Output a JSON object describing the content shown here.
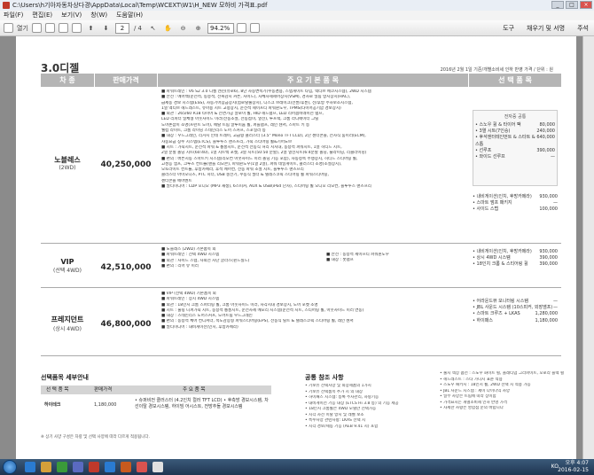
{
  "window": {
    "title": "C:\\Users\\h기아자동차상다경\\AppData\\Local\\Temp\\WCEXT\\W1\\H_NEW 모하비 가격표.pdf"
  },
  "menu": [
    "파일(F)",
    "편집(E)",
    "보기(V)",
    "창(W)",
    "도움말(H)"
  ],
  "toolbar": {
    "open": "열기",
    "page_current": "2",
    "page_total": "/ 4",
    "zoom": "94.2%",
    "tools": "도구",
    "fill_sign": "채우기 및 서명",
    "comment": "주석"
  },
  "doc": {
    "title": "3.0디젤",
    "note": "2016년 2월 1일 기준/개별소비세 인하 반영 가격 / 단위 : 원",
    "headers": {
      "model": "차 종",
      "price": "판매가격",
      "features": "주 요 기 본 품 목",
      "options": "선 택 품 목"
    },
    "models": [
      {
        "name": "노블레스",
        "sub": "(2WD)",
        "price": "40,250,000",
        "features": [
          "■ 파워트레인 : V6 S2 3.0 디젤 엔진(유로6), 8단 자동변속기(수동겸용, 스텝게이트 타입, 액티브 에코시스템), 2WD 시스템",
          "■ 안전 : 에어백(운전석, 동승석, 전복감지 커튼, 사이드), 차체자세제어장치(VSM), 경사로 밀림 방지장치(HAC),",
          "   급제동 경보 시스템(ESS), 차동기어잠금장치(험로탈출장치), 디스크 브레이크(전륜/후륜), 전/후방 주차보조시스템,",
          "   1열 액티브 헤드레스트, 유아용 시트 고정장치, 운전석 세이프티 파워윈도우, TPMS(타이어공기압 경보장치)",
          "■ 외관 : 265/60 R18 타이어 & 전면가공 알로이 휠, HID 헤드램프, LED 리어콤비네이션 램프,",
          "   LED 리피터 일체형 아웃사이드 미러(전동조절, 전동접이, 열선), 루프랙, 크롬 라디에이터 그릴",
          "   도어손잡이 조명(프런트 도어), 메탈 트림 알루미늄 휠, 퍼들램프, 레인 센서, 스마트 키 등",
          "   웰컴 라이트, 크롬 라이닝 스테인리스 도어 스커프, 스포일러 등",
          "■ 내장 : 우드그레인, 리거지 인테 트레이, 고급형 클러스터 (3.5\" Mono TFT LCD), 2단 센터콘솔, 전자식 룸미러(ECM),",
          "   자동요금 징수 시스템(ETCS), 블루투스 핸즈프리, 가죽 스티어링 휠&기어노브",
          "■ 시트 : 가죽시트, 운전석 파워 & 통풍시트, 운전석 전동식 허리 지지대, 동승석 파워시트, 1열 히티드 시트,",
          "   2열 분할 폴딩 시트(60:40), 1열 시트백 포켓, 3열 시트(50:50 분할), 2열 열선시트(6:4분할 폴딩, 슬라이딩, 리클라이닝)",
          "■ 편의 : 버튼시동 스마트키 시스템(리모컨 아웃사이드 미러 폴딩 기능 포함), 자동정속 주행장치, 히티드 스티어링 휠,",
          "   고성능 앰프, 크루즈 컨트롤(핸들 리모콘), 파워윈도우(1열 2열), 파워 테일게이트, 클러스터 조명(조절장치),",
          "   오토라이트 컨트롤, 후방카메라, 후석 에어컨, 전동 파워 조절 시트, 블루투스 핸즈프리",
          "   클러스터 아이오니즈, PTC 히터, USB 충전기, 수동식 필터 & 텔레스코픽 스티어링 휠 파워스티어링,",
          "   센터콘솔 에어벤트",
          "■ 멀티미디어 : CDP 오디오 (MP3 재생), 6스피커, AUX & USB(iPod 단자), 스티어링 휠 오디오 리모컨, 블루투스 핸즈프리"
        ],
        "options_box_title": "전자증 공통",
        "options": [
          [
            "• 스노우 휠 & 타이어 팩",
            "80,000"
          ],
          [
            "• 3열 시트(7인승)",
            "240,000"
          ],
          [
            "• 후석엔터테인먼트 & 스타트 & 스톱",
            "640,000"
          ],
          [
            "• 선루프",
            "390,000"
          ],
          [
            "• 와이드 선루프",
            "—"
          ]
        ],
        "options2": [
          [
            "• 내비게이션(인치, 후방카메라)",
            "930,000"
          ],
          [
            "• 스마트 앰프 패키지",
            "—"
          ],
          [
            "• 사이드 스텝",
            "100,000"
          ]
        ]
      },
      {
        "name": "VIP",
        "sub": "(선택 4WD)",
        "price": "42,510,000",
        "features": [
          "■ 노블레스 (2WD) 기본품목 외",
          "■ 파워트레인 : 선택 4WD 시스템",
          "■ 외관 : 사이드 스텝, 자외선 차단 글라스(윈드실드)",
          "■ 편의 : 리어 뷰 미러"
        ],
        "features_right": [
          "■ 안전 : 동승석 세이프티 파워윈도우",
          "■ 내장 : 풋램프"
        ],
        "options": [
          [
            "• 내비게이션(인치, 후방카메라)",
            "930,000"
          ],
          [
            "• 상시 4WD 시스템",
            "390,000"
          ],
          [
            "• 18인치 크롬 & 스티어링 휠",
            "390,000"
          ]
        ]
      },
      {
        "name": "프레지던트",
        "sub": "(상시 4WD)",
        "price": "46,800,000",
        "features": [
          "■ VIP (선택 4WD) 기본품목 외",
          "■ 파워트레인 : 상시 4WD 시스템",
          "■ 외관 : 18인치 크롬 스퍼터링 휠, 크롬 아웃사이드 미러, 사각지대 경보장치, 도어 포켓 조명",
          "■ 시트 : 풀링 니퍼가죽 시트, 동승석 통풍시트, 운전자세 메모리 시스템(운전석 시트, 스티어링 휠, 아웃사이드 미러 연동)",
          "■ 내장 : 스테인리스 도어스커프, 도어트림 우드그레인",
          "■ 편의 : 동승석 체어 컨디셔너, 속도감응형 파워스티어링(EPS), 전동식 틸트 & 텔레스코픽 스티어링 휠, 레인 센서",
          "■ 멀티미디어 : 내비게이션(인치, 후방카메라)"
        ],
        "options": [
          [
            "• 어라운드뷰 모니터링 시스템",
            "—"
          ],
          [
            "• JBL 사운드 시스템 (10스피커, 외장앰프)",
            "—"
          ],
          [
            "• 스마트 크루즈 + LKAS",
            "1,280,000"
          ],
          [
            "• 하이패스",
            "1,180,000"
          ]
        ]
      }
    ],
    "section": {
      "title": "선택품목 세부안내",
      "cols": [
        "선 택 품 목",
        "판매가격",
        "주 요 품 목"
      ],
      "rows": [
        {
          "item": "하이테크",
          "price": "1,180,000",
          "desc": "• 슈퍼비전 클러스터 (4.2인치 컬러 TFT LCD) • 후측방 경보시스템, 차선이탈 경보시스템, 하이빔 어시스트, 전방추돌 경보시스템"
        }
      ],
      "footnote": "※ 상기 사양 구성은 차량 및 선택 사양에 따라 다르게 적용됩니다."
    },
    "notes": {
      "title": "공통 참조 사항",
      "left": [
        "• 기보유 선택사양 및 외장제품의 1가지",
        "• 기보유 선택품목 추가 시 의 내장",
        "• 하이패스 시스템: 등록 주차관리, 차량기능",
        "• 내비게이션 기능 내장 (ETCS Hi 3.8 등) 의 기능 제공",
        "• 18인치 크롬휠은 4WD 모델만 선택가능",
        "• 시각 차선 이탈 방지 및 레벨 보조",
        "• 특수사양 관련사항: LKAS 선택 시",
        "• 시각 경보/제동 기능 (AEB 9.41 시) 포함"
      ],
      "right": [
        "• 출시 색상 옵션 : 스노우 화이트 펄, 플래티넘 그라파이트, 오로라 블랙 펄",
        "• 헤드레스트 : 스타 가니시 표준 적용",
        "• 스노우 패키지 : 18인치 휠, 2WD 선택 시 적용 가능",
        "• JBL 사운드 시스템 : 세미 다이나믹 사양",
        "• 일부 사양은 트림에 따라 상이함",
        "• 가격표시는 개별소비세 인하 반영 가격",
        "• 자세한 사항은 영업점 문의 바랍니다"
      ]
    }
  },
  "taskbar": {
    "lang": "KO",
    "time": "오후 4:07",
    "date": "2016-02-15"
  }
}
